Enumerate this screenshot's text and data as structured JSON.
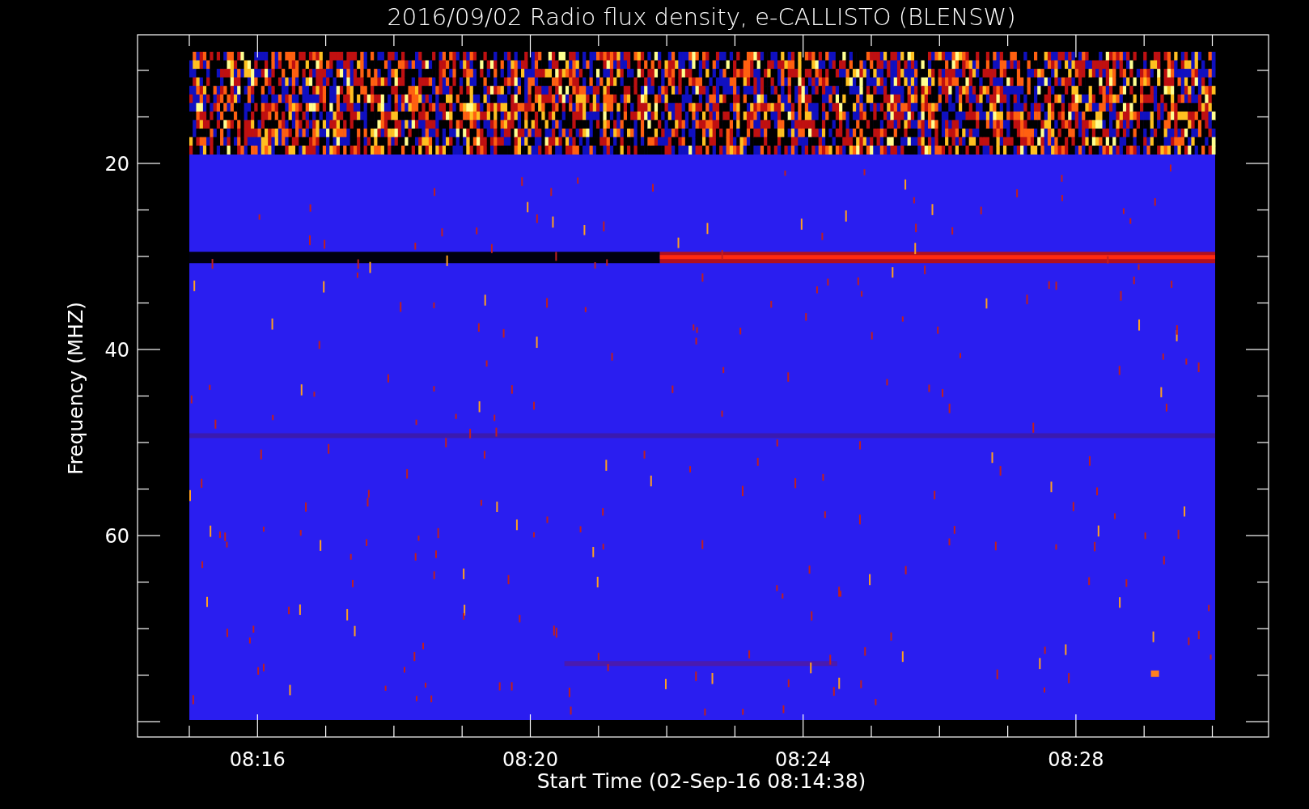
{
  "title": "2016/09/02  Radio flux density, e-CALLISTO (BLENSW)",
  "y_axis": {
    "label": "Frequency (MHZ)",
    "ticks": [
      "20",
      "40",
      "60"
    ]
  },
  "x_axis": {
    "label": "Start Time (02-Sep-16 08:14:38)",
    "ticks": [
      "08:16",
      "08:20",
      "08:24",
      "08:28"
    ]
  }
}
